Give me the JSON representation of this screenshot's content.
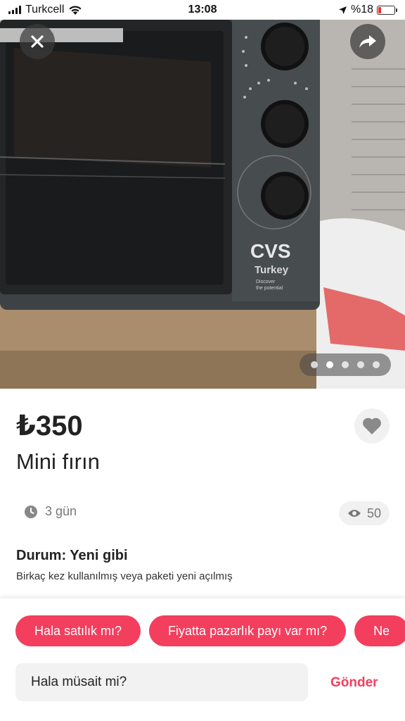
{
  "status_bar": {
    "carrier": "Turkcell",
    "time": "13:08",
    "battery": "%18"
  },
  "photo": {
    "dot_count": 5,
    "active_dot": 1,
    "brand_text": "CVS",
    "brand_sub": "Turkey",
    "brand_tagline_1": "Discover",
    "brand_tagline_2": "the potential"
  },
  "listing": {
    "price": "₺350",
    "title": "Mini fırın",
    "posted": "3 gün",
    "views": "50",
    "condition_title": "Durum: Yeni gibi",
    "condition_desc": "Birkaç kez kullanılmış veya paketi yeni açılmış"
  },
  "quick_replies": [
    {
      "label": "Hala satılık mı?"
    },
    {
      "label": "Fiyatta pazarlık payı var mı?"
    },
    {
      "label": "Ne"
    }
  ],
  "composer": {
    "value": "Hala müsait mi?",
    "send_label": "Gönder"
  },
  "colors": {
    "accent": "#f33e5e"
  }
}
